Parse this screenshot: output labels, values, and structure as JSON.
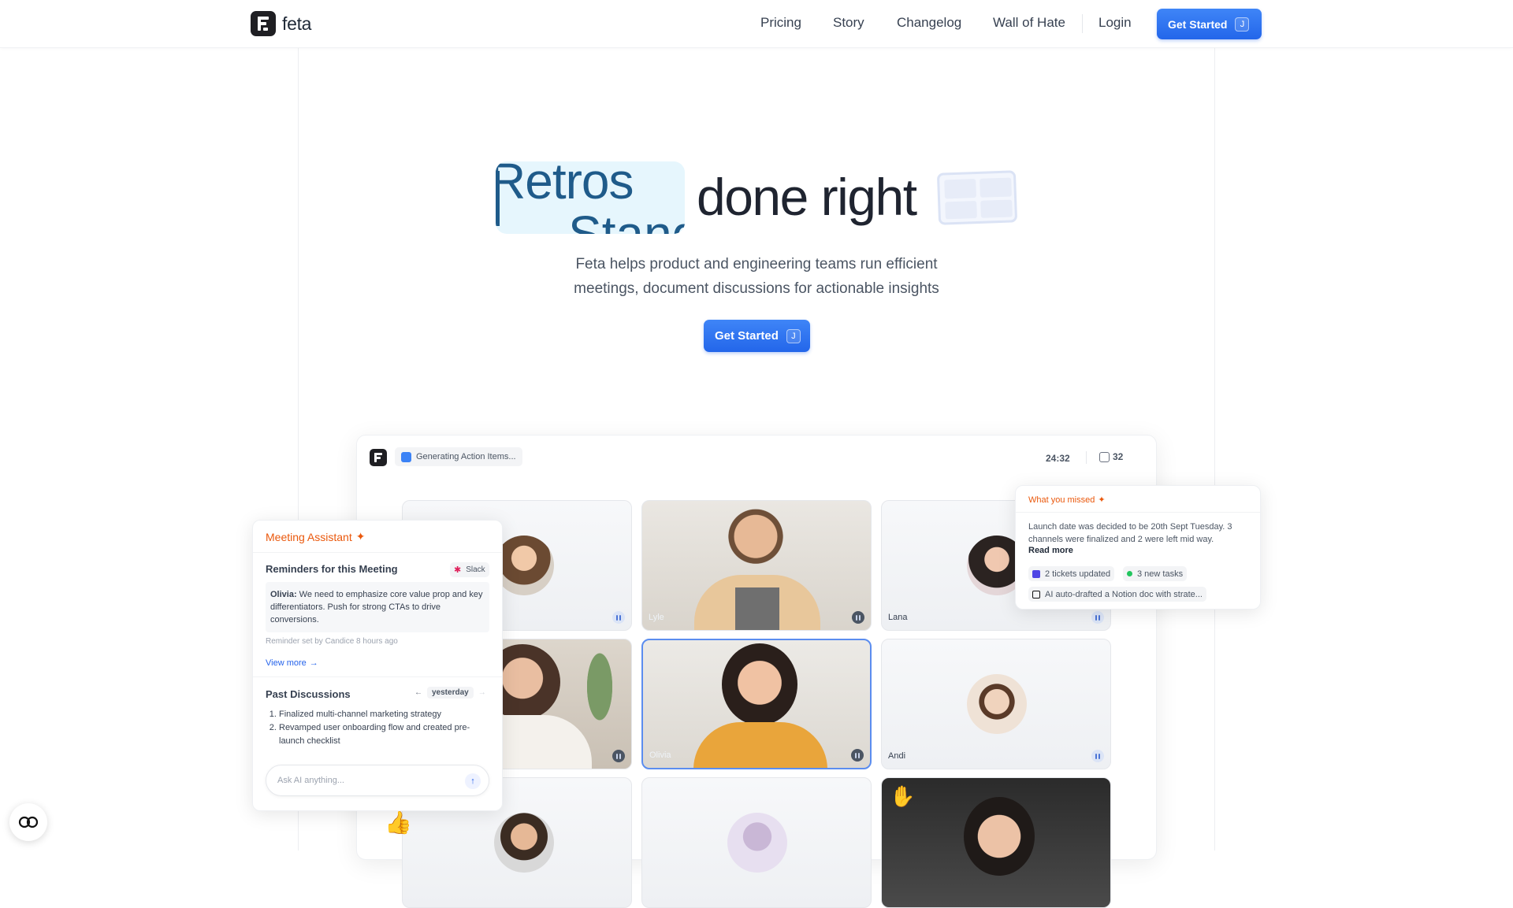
{
  "nav": {
    "brand": "feta",
    "links": [
      "Pricing",
      "Story",
      "Changelog",
      "Wall of Hate"
    ],
    "login": "Login",
    "cta": "Get Started",
    "cta_key": "J"
  },
  "hero": {
    "rotating_word_1": "Retros",
    "rotating_word_2": "Stand",
    "title_rest": "done right",
    "subtitle_line1": "Feta helps product and engineering teams run efficient",
    "subtitle_line2": "meetings, document discussions for actionable insights",
    "cta": "Get Started",
    "cta_key": "J"
  },
  "app": {
    "status_chip": "Generating Action Items...",
    "timer": "24:32",
    "participants": "32",
    "tiles": [
      {
        "name": ""
      },
      {
        "name": "Lyle"
      },
      {
        "name": "Lana"
      },
      {
        "name": ""
      },
      {
        "name": "Olivia"
      },
      {
        "name": "Andi"
      }
    ]
  },
  "assistant": {
    "title": "Meeting Assistant",
    "reminders_heading": "Reminders for this Meeting",
    "slack_label": "Slack",
    "reminder_author": "Olivia:",
    "reminder_text": " We need to emphasize core value prop and key differentiators. Push for strong CTAs to drive conversions.",
    "reminder_meta": "Reminder set by Candice 8 hours ago",
    "view_more": "View more",
    "past_heading": "Past Discussions",
    "past_nav_label": "yesterday",
    "past_items": [
      "Finalized multi-channel marketing strategy",
      "Revamped user onboarding flow and created pre-launch checklist"
    ],
    "ask_placeholder": "Ask AI anything..."
  },
  "missed": {
    "title": "What you missed",
    "body": "Launch date was decided to be 20th Sept Tuesday. 3 channels were finalized and 2 were left mid way.",
    "read_more": "Read more",
    "chip_tickets": "2 tickets updated",
    "chip_tasks": "3 new tasks",
    "chip_notion": "AI auto-drafted a Notion doc with strate..."
  },
  "colors": {
    "accent": "#2563eb",
    "assistant_orange": "#ea580c",
    "rotating_word_bg": "#e6f6fd",
    "rotating_word_text": "#1f5b8a"
  }
}
